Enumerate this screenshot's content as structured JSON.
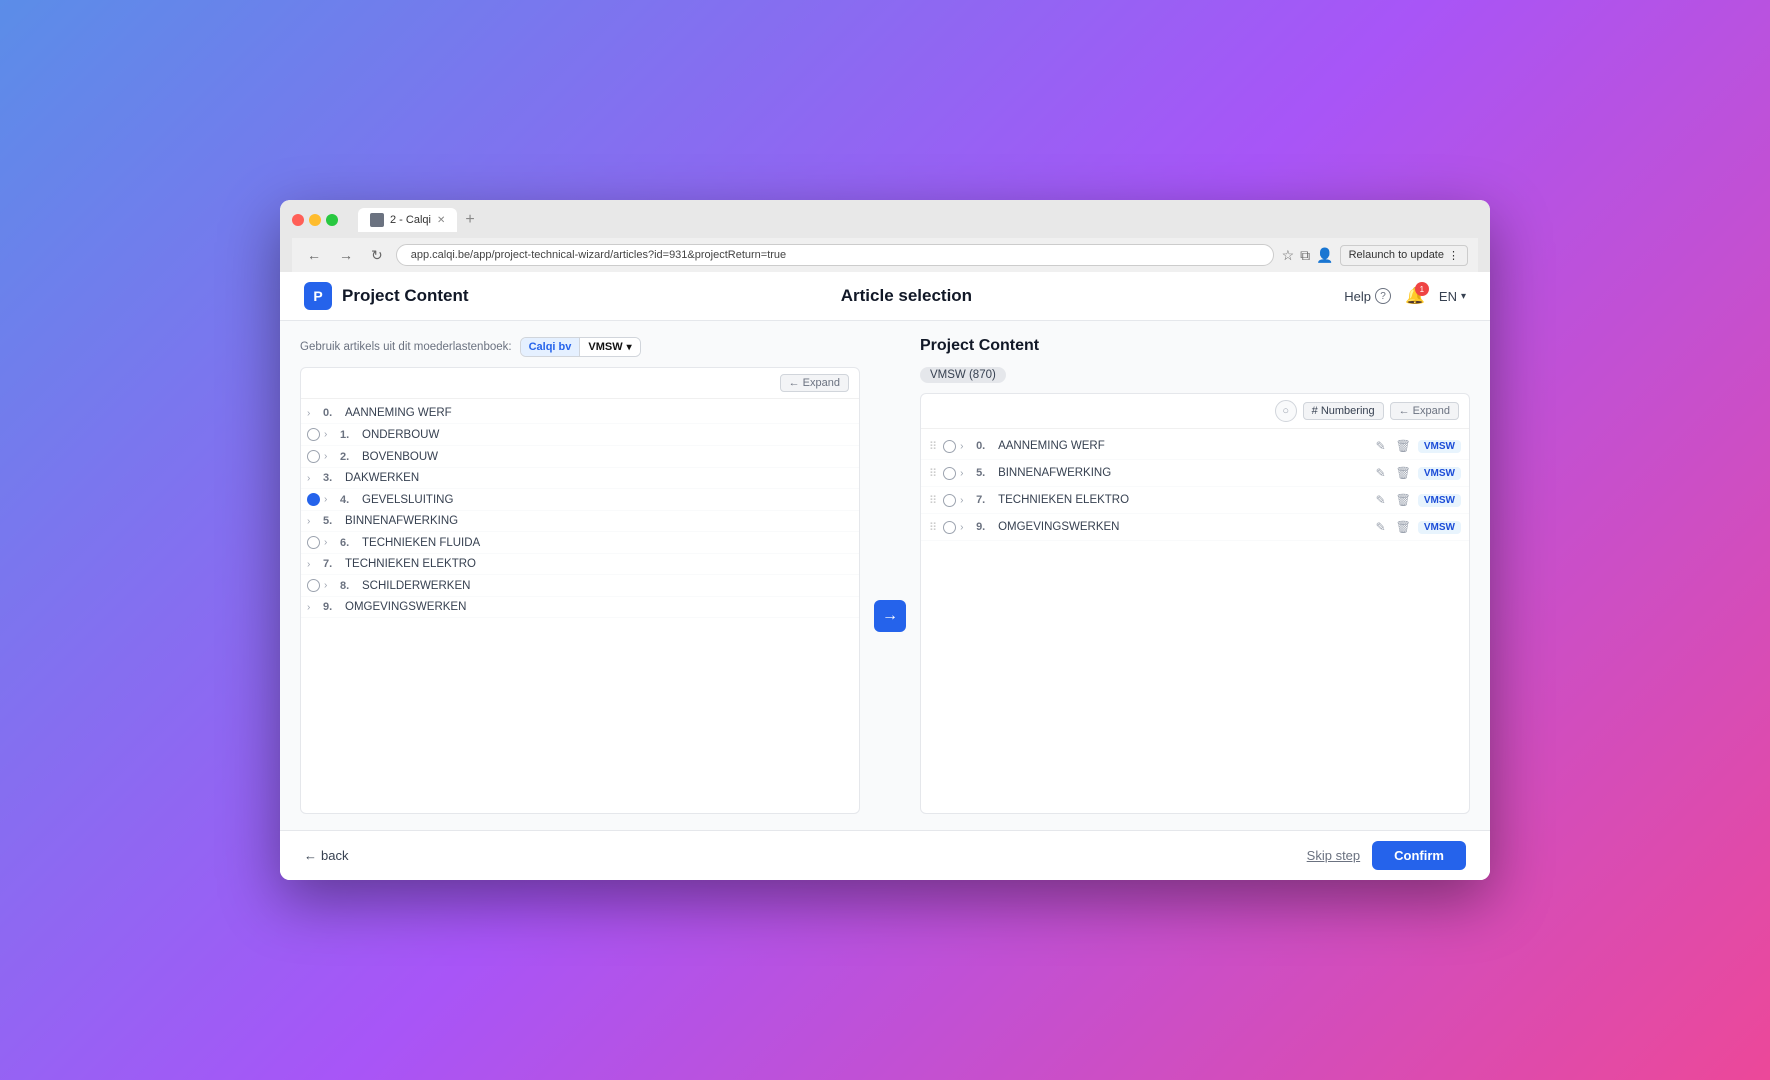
{
  "browser": {
    "tab_title": "2 - Calqi",
    "url": "app.calqi.be/app/project-technical-wizard/articles?id=931&projectReturn=true",
    "relaunch_label": "Relaunch to update"
  },
  "app": {
    "title": "Project Content",
    "page_heading": "Article selection",
    "logo_letter": "P"
  },
  "header": {
    "help_label": "Help",
    "lang_label": "EN",
    "notif_count": "1"
  },
  "left_panel": {
    "moeder_label": "Gebruik artikels uit dit moederlastenboek:",
    "calqi_label": "Calqi bv",
    "vmsw_label": "VMSW",
    "expand_label": "← Expand",
    "items": [
      {
        "num": "0.",
        "label": "AANNEMING WERF",
        "radio": false,
        "selected": false
      },
      {
        "num": "1.",
        "label": "ONDERBOUW",
        "radio": true,
        "selected": false
      },
      {
        "num": "2.",
        "label": "BOVENBOUW",
        "radio": true,
        "selected": false
      },
      {
        "num": "3.",
        "label": "DAKWERKEN",
        "radio": false,
        "selected": false
      },
      {
        "num": "4.",
        "label": "GEVELSLUITING",
        "radio": true,
        "selected": true
      },
      {
        "num": "5.",
        "label": "BINNENAFWERKING",
        "radio": false,
        "selected": false
      },
      {
        "num": "6.",
        "label": "TECHNIEKEN FLUIDA",
        "radio": true,
        "selected": false
      },
      {
        "num": "7.",
        "label": "TECHNIEKEN ELEKTRO",
        "radio": false,
        "selected": false
      },
      {
        "num": "8.",
        "label": "SCHILDERWERKEN",
        "radio": true,
        "selected": false
      },
      {
        "num": "9.",
        "label": "OMGEVINGSWERKEN",
        "radio": false,
        "selected": false
      }
    ]
  },
  "right_panel": {
    "title": "Project Content",
    "vmsw_count": "VMSW (870)",
    "expand_label": "← Expand",
    "numbering_label": "# Numbering",
    "items": [
      {
        "num": "0.",
        "label": "AANNEMING WERF",
        "tag": "VMSW"
      },
      {
        "num": "5.",
        "label": "BINNENAFWERKING",
        "tag": "VMSW"
      },
      {
        "num": "7.",
        "label": "TECHNIEKEN ELEKTRO",
        "tag": "VMSW"
      },
      {
        "num": "9.",
        "label": "OMGEVINGSWERKEN",
        "tag": "VMSW"
      }
    ]
  },
  "footer": {
    "back_label": "back",
    "skip_label": "Skip step",
    "confirm_label": "Confirm"
  }
}
